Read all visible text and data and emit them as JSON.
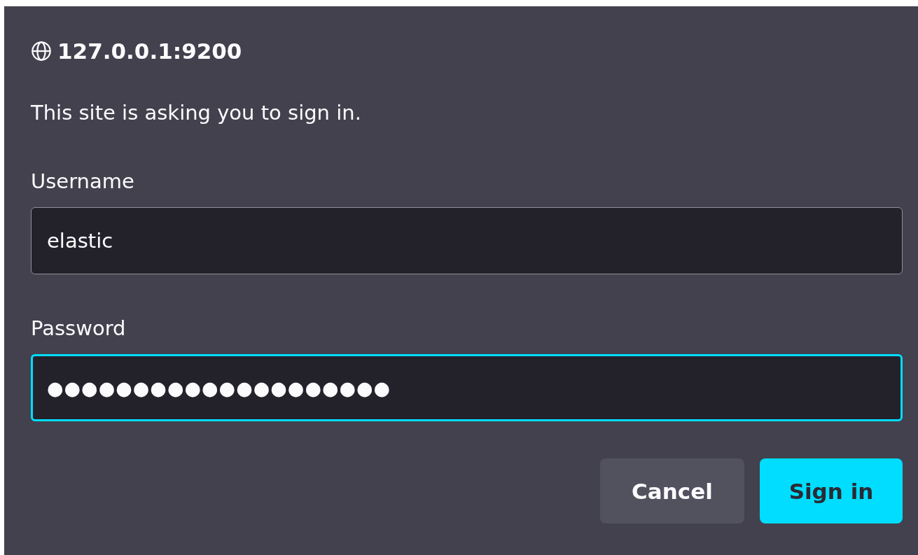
{
  "dialog": {
    "origin": "127.0.0.1:9200",
    "message": "This site is asking you to sign in.",
    "fields": [
      {
        "label": "Username",
        "value": "elastic",
        "focused": false
      },
      {
        "label": "Password",
        "value": "●●●●●●●●●●●●●●●●●●●●",
        "focused": true
      }
    ],
    "buttons": [
      {
        "label": "Cancel",
        "kind": "secondary"
      },
      {
        "label": "Sign in",
        "kind": "primary"
      }
    ]
  }
}
